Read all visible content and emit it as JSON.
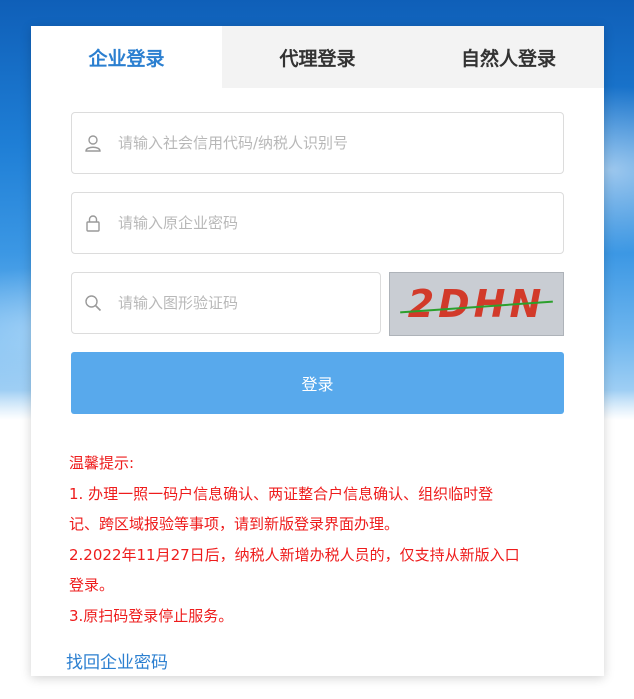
{
  "tabs": [
    {
      "label": "企业登录",
      "active": true
    },
    {
      "label": "代理登录",
      "active": false
    },
    {
      "label": "自然人登录",
      "active": false
    }
  ],
  "form": {
    "credit_code_placeholder": "请输入社会信用代码/纳税人识别号",
    "password_placeholder": "请输入原企业密码",
    "captcha_placeholder": "请输入图形验证码",
    "captcha_text": "2DHN",
    "login_label": "登录"
  },
  "tips": {
    "title": "温馨提示:",
    "lines": [
      "1. 办理一照一码户信息确认、两证整合户信息确认、组织临时登",
      "记、跨区域报验等事项，请到新版登录界面办理。",
      "2.2022年11月27日后，纳税人新增办税人员的，仅支持从新版入口",
      "登录。",
      "3.原扫码登录停止服务。"
    ]
  },
  "forgot_label": "找回企业密码",
  "colors": {
    "accent": "#2b7fd0",
    "button": "#58a9ec",
    "warning": "#ee1c1c"
  },
  "icons": {
    "user": "user-icon",
    "lock": "lock-icon",
    "search": "search-icon"
  }
}
